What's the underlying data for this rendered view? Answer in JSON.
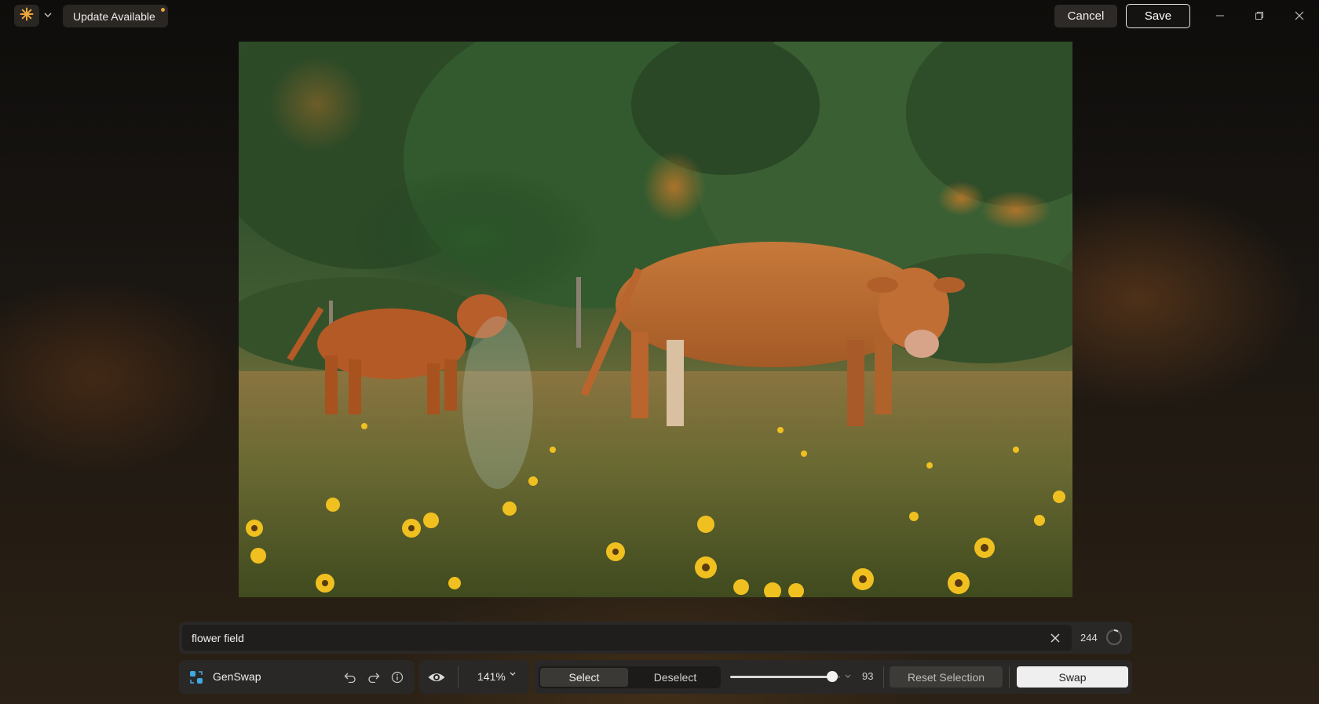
{
  "topbar": {
    "app_icon": "sun-burst-icon",
    "update_label": "Update Available",
    "cancel_label": "Cancel",
    "save_label": "Save",
    "window_controls": [
      "minimize-icon",
      "restore-icon",
      "close-icon"
    ]
  },
  "canvas": {
    "description_icon": "photo",
    "content": "Cow and calf grazing in a meadow with yellow flowers"
  },
  "prompt": {
    "value": "flower field",
    "char_count": "244"
  },
  "toolbar": {
    "tool_label": "GenSwap",
    "zoom": "141%",
    "select_label": "Select",
    "deselect_label": "Deselect",
    "brush_size": "93",
    "reset_label": "Reset Selection",
    "swap_label": "Swap"
  },
  "colors": {
    "accent": "#e8a040",
    "genswap_icon": "#3fa9e0"
  }
}
